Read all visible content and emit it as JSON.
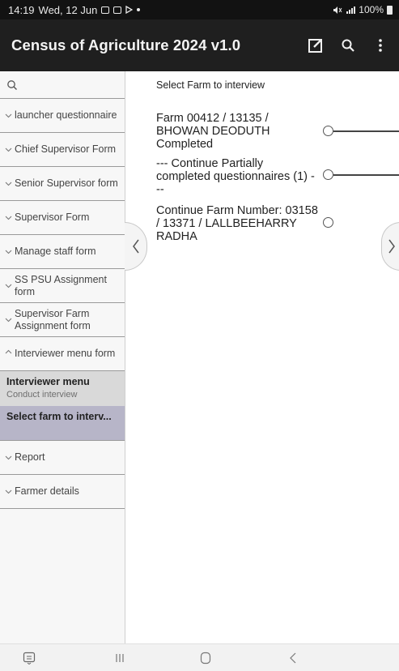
{
  "status_bar": {
    "time": "14:19",
    "date": "Wed, 12 Jun",
    "battery": "100%"
  },
  "app_bar": {
    "title": "Census of Agriculture 2024 v1.0",
    "icons": [
      "edit-icon",
      "search-icon",
      "more-vert-icon"
    ]
  },
  "sidebar": {
    "search_icon": "search-icon",
    "items": [
      {
        "label": "launcher questionnaire",
        "state": "collapsed"
      },
      {
        "label": "Chief Supervisor Form",
        "state": "collapsed"
      },
      {
        "label": "Senior Supervisor form",
        "state": "collapsed"
      },
      {
        "label": "Supervisor Form",
        "state": "collapsed"
      },
      {
        "label": "Manage staff form",
        "state": "collapsed"
      },
      {
        "label": "SS PSU Assignment form",
        "state": "collapsed"
      },
      {
        "label": "Supervisor Farm Assignment form",
        "state": "collapsed"
      },
      {
        "label": "Interviewer menu form",
        "state": "expanded"
      },
      {
        "label": "Report",
        "state": "collapsed"
      },
      {
        "label": "Farmer details",
        "state": "collapsed"
      }
    ],
    "sub_header": {
      "title": "Interviewer menu",
      "subtitle": "Conduct interview"
    },
    "active_sub_item": "Select farm to interv..."
  },
  "main": {
    "title": "Select Farm to interview",
    "options": [
      {
        "text": "Farm 00412 / 13135 / BHOWAN DEODUTH Completed"
      },
      {
        "text": "--- Continue Partially completed questionnaires (1) ---"
      },
      {
        "text": "Continue Farm Number: 03158 / 13371 / LALLBEEHARRY RADHA"
      }
    ]
  },
  "colors": {
    "app_bar": "#1f1f1f",
    "status_bar": "#121212",
    "active_item": "#b7b5c8",
    "sub_header": "#d9d9d9"
  }
}
